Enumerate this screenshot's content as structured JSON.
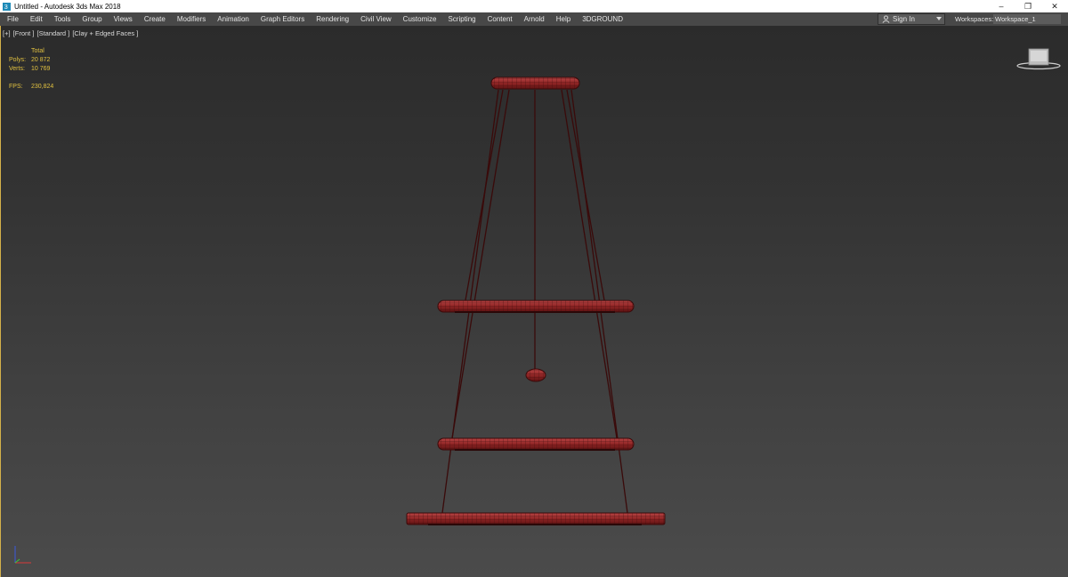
{
  "window": {
    "title": "Untitled - Autodesk 3ds Max 2018",
    "controls": {
      "minimize": "–",
      "restore": "❐",
      "close": "✕"
    }
  },
  "menubar": {
    "items": [
      "File",
      "Edit",
      "Tools",
      "Group",
      "Views",
      "Create",
      "Modifiers",
      "Animation",
      "Graph Editors",
      "Rendering",
      "Civil View",
      "Customize",
      "Scripting",
      "Content",
      "Arnold",
      "Help",
      "3DGROUND"
    ],
    "sign_in": "Sign In",
    "workspaces_label": "Workspaces:",
    "workspace_value": "Workspace_1"
  },
  "viewport": {
    "labels": [
      "[+]",
      "[Front ]",
      "[Standard ]",
      "[Clay + Edged Faces ]"
    ],
    "stats": {
      "header": "Total",
      "polys_label": "Polys:",
      "polys_value": "20 872",
      "verts_label": "Verts:",
      "verts_value": "10 769",
      "fps_label": "FPS:",
      "fps_value": "230,824"
    },
    "colors": {
      "wire": "#3a0a0a",
      "mesh_fill": "#8f2525",
      "mesh_light": "#b94545",
      "stats_text": "#e0c040"
    }
  }
}
